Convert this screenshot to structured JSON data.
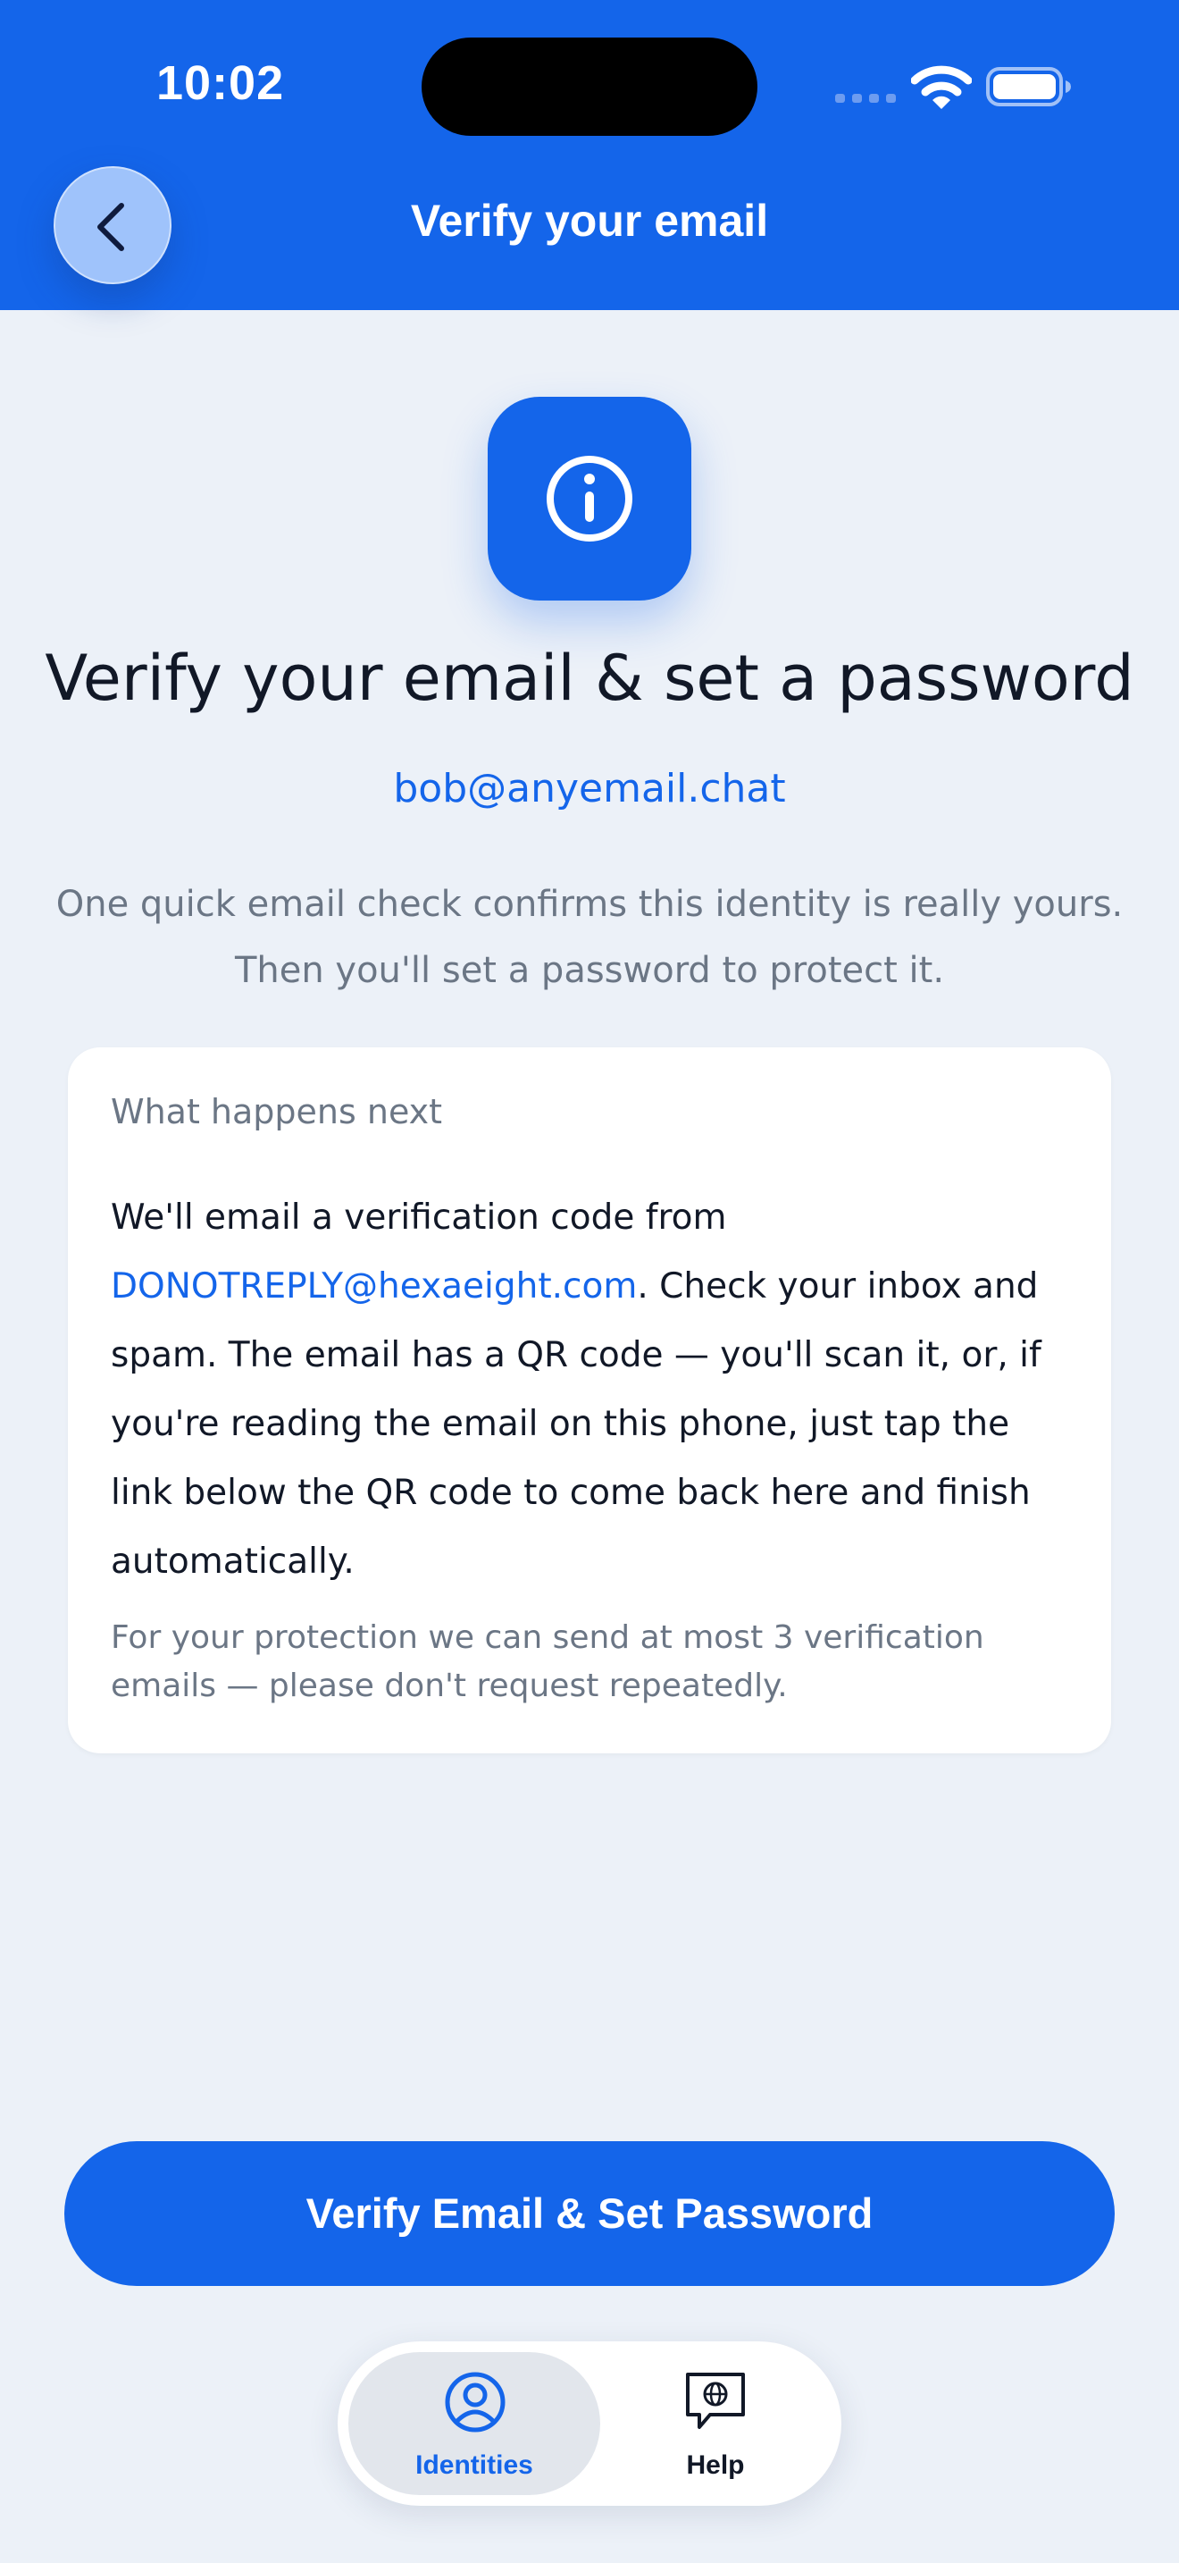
{
  "status_bar": {
    "time": "10:02"
  },
  "header": {
    "title": "Verify your email",
    "back_icon": "chevron-left-icon"
  },
  "hero": {
    "icon": "info-icon",
    "heading": "Verify your email & set a password",
    "email": "bob@anyemail.chat",
    "intro_line1": "One quick email check confirms this identity is really yours.",
    "intro_line2": "Then you'll set a password to protect it."
  },
  "card": {
    "title": "What happens next",
    "body_prefix": "We'll email a verification code from ",
    "sender_email": "DONOTREPLY@hexaeight.com",
    "body_suffix": ". Check your inbox and spam. The email has a QR code — you'll scan it, or, if you're reading the email on this phone, just tap the link below the QR code to come back here and finish automatically.",
    "note": "For your protection we can send at most 3 verification emails — please don't request repeatedly."
  },
  "primary_button": {
    "label": "Verify Email & Set Password"
  },
  "tab_bar": {
    "tabs": [
      {
        "label": "Identities",
        "icon": "person-circle-icon",
        "selected": true
      },
      {
        "label": "Help",
        "icon": "chat-globe-icon",
        "selected": false
      }
    ]
  },
  "colors": {
    "accent": "#1465ea",
    "background": "#ecf1f8",
    "text_primary": "#111827",
    "text_secondary": "#6b7685"
  }
}
